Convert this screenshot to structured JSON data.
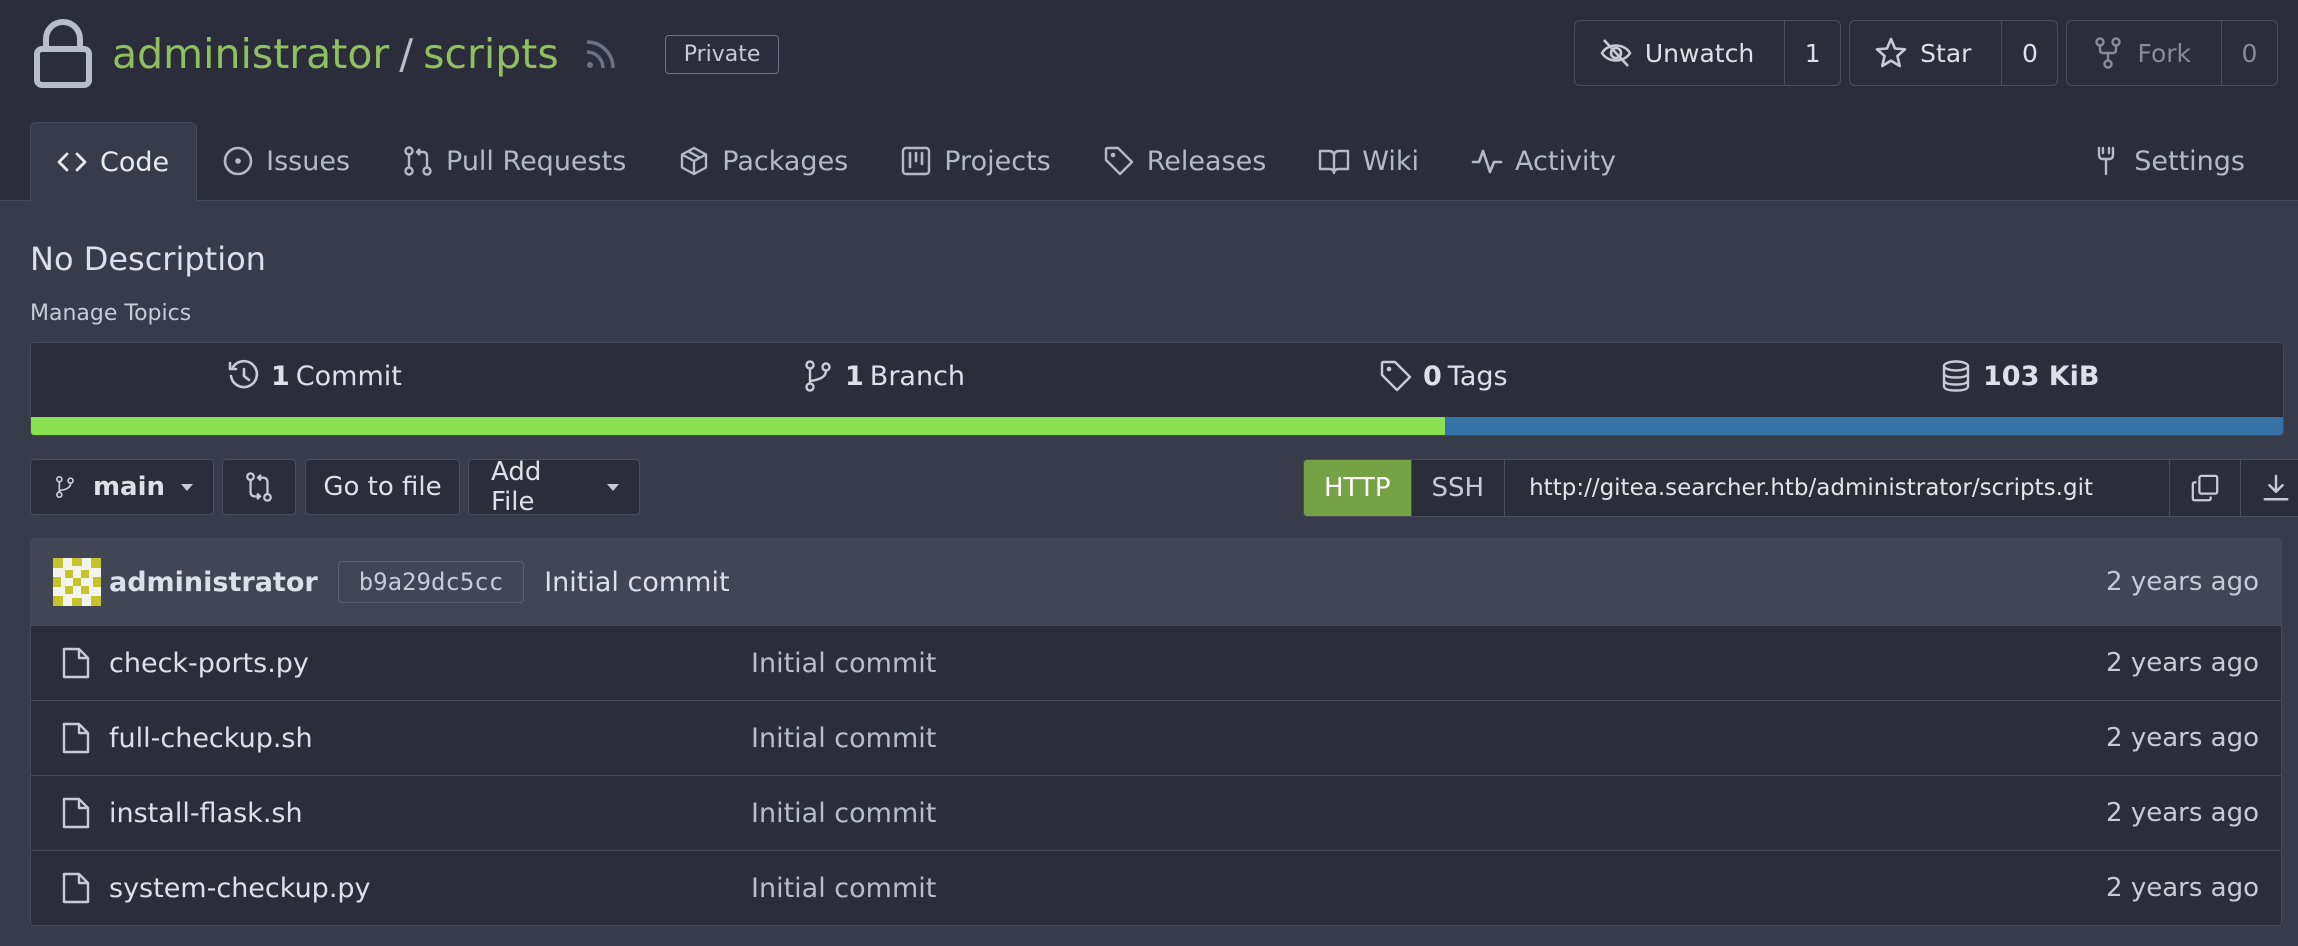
{
  "repo": {
    "owner": "administrator",
    "name": "scripts",
    "separator": "/",
    "visibility": "Private",
    "description": "No Description",
    "manage_topics": "Manage Topics"
  },
  "actions": {
    "watch": {
      "label": "Unwatch",
      "count": "1"
    },
    "star": {
      "label": "Star",
      "count": "0"
    },
    "fork": {
      "label": "Fork",
      "count": "0"
    }
  },
  "tabs": [
    {
      "label": "Code",
      "icon": "code-icon"
    },
    {
      "label": "Issues",
      "icon": "issue-icon"
    },
    {
      "label": "Pull Requests",
      "icon": "pull-request-icon"
    },
    {
      "label": "Packages",
      "icon": "package-icon"
    },
    {
      "label": "Projects",
      "icon": "project-icon"
    },
    {
      "label": "Releases",
      "icon": "tag-icon"
    },
    {
      "label": "Wiki",
      "icon": "book-icon"
    },
    {
      "label": "Activity",
      "icon": "pulse-icon"
    }
  ],
  "settings_tab": {
    "label": "Settings",
    "icon": "tools-icon"
  },
  "stats": {
    "commits": {
      "count": "1",
      "label": "Commit"
    },
    "branches": {
      "count": "1",
      "label": "Branch"
    },
    "tags": {
      "count": "0",
      "label": "Tags"
    },
    "size": {
      "value": "103 KiB"
    }
  },
  "language_bar": [
    {
      "color": "#89e051",
      "fraction": 0.628
    },
    {
      "color": "#3572a5",
      "fraction": 0.372
    }
  ],
  "toolbar": {
    "branch": "main",
    "goto_file": "Go to file",
    "add_file": "Add File"
  },
  "clone": {
    "http": "HTTP",
    "ssh": "SSH",
    "url": "http://gitea.searcher.htb/administrator/scripts.git"
  },
  "latest_commit": {
    "author": "administrator",
    "sha": "b9a29dc5cc",
    "message": "Initial commit",
    "age": "2 years ago"
  },
  "files": [
    {
      "name": "check-ports.py",
      "commit": "Initial commit",
      "age": "2 years ago"
    },
    {
      "name": "full-checkup.sh",
      "commit": "Initial commit",
      "age": "2 years ago"
    },
    {
      "name": "install-flask.sh",
      "commit": "Initial commit",
      "age": "2 years ago"
    },
    {
      "name": "system-checkup.py",
      "commit": "Initial commit",
      "age": "2 years ago"
    }
  ],
  "colors": {
    "background": "#383c4a",
    "header": "#2b2e3a",
    "accent_green": "#75a244",
    "link_green": "#8fbf5f"
  }
}
